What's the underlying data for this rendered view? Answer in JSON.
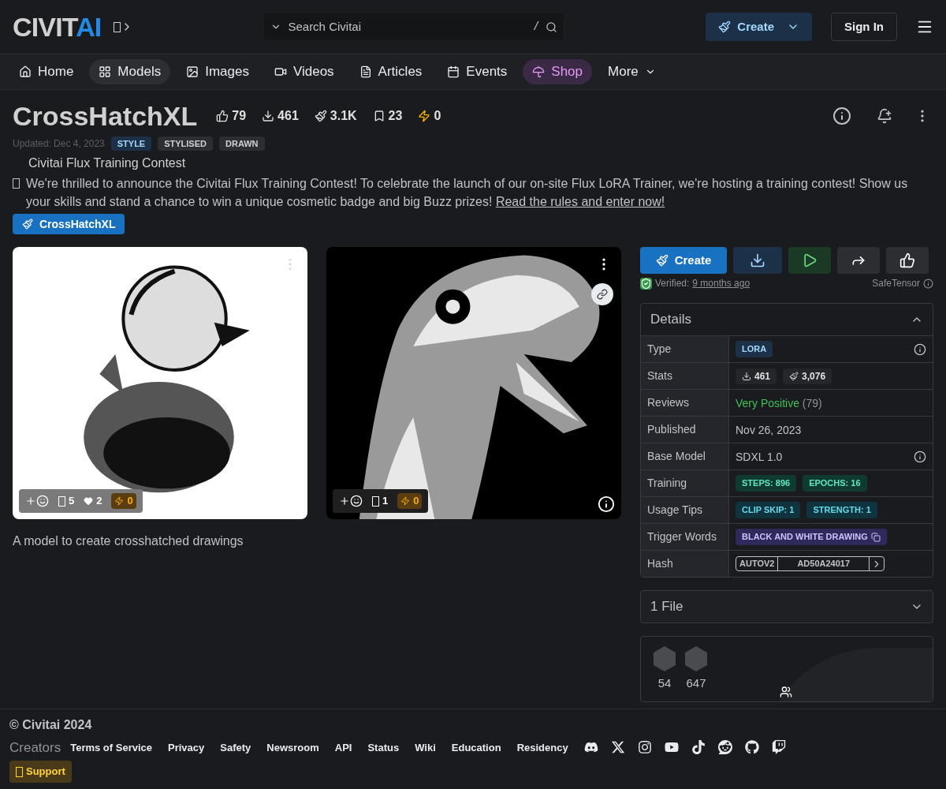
{
  "header": {
    "logo": {
      "main": "CIVIT",
      "accent": "AI"
    },
    "search": {
      "placeholder": "Search Civitai",
      "shortcut": "/"
    },
    "create_button": "Create",
    "sign_in_button": "Sign In"
  },
  "nav": [
    {
      "label": "Home",
      "kind": "link",
      "selected": false
    },
    {
      "label": "Models",
      "kind": "link",
      "selected": true
    },
    {
      "label": "Images",
      "kind": "link",
      "selected": false
    },
    {
      "label": "Videos",
      "kind": "link",
      "selected": false
    },
    {
      "label": "Articles",
      "kind": "link",
      "selected": false
    },
    {
      "label": "Events",
      "kind": "link",
      "selected": false
    },
    {
      "label": "Shop",
      "kind": "shop",
      "selected": false
    },
    {
      "label": "More",
      "kind": "menu",
      "selected": false
    }
  ],
  "model": {
    "title": "CrossHatchXL",
    "stats": [
      {
        "kind": "like",
        "value": "79"
      },
      {
        "kind": "download",
        "value": "461"
      },
      {
        "kind": "brush",
        "value": "3.1K"
      },
      {
        "kind": "bookmark",
        "value": "23"
      },
      {
        "kind": "bolt",
        "value": "0"
      }
    ],
    "updated": "Updated: Dec 4, 2023",
    "tags": [
      {
        "label": "STYLE",
        "kind": "category"
      },
      {
        "label": "STYLISED",
        "kind": "tag"
      },
      {
        "label": "DRAWN",
        "kind": "tag"
      }
    ],
    "description": "A model to create crosshatched drawings"
  },
  "announcement": {
    "title": "Civitai Flux Training Contest",
    "text": "We're thrilled to announce the Civitai Flux Training Contest! To celebrate the launch of our on-site Flux LoRA Trainer, we're hosting a training contest! Show us your skills and stand a chance to win a unique cosmetic badge and big Buzz prizes!",
    "link": "Read the rules and enter now!",
    "button": "CrossHatchXL"
  },
  "images": [
    {
      "kind": "light",
      "reactions": [
        {
          "kind": "glyph",
          "value": "5"
        },
        {
          "kind": "heart",
          "value": "2"
        }
      ],
      "buzz": "0"
    },
    {
      "kind": "dark",
      "reactions": [
        {
          "kind": "glyph",
          "value": "1"
        }
      ],
      "buzz": "0"
    }
  ],
  "actions": {
    "create": "Create",
    "verified_label": "Verified:",
    "verified_time": "9 months ago",
    "format": "SafeTensor"
  },
  "details": {
    "title": "Details",
    "expanded": true,
    "rows": [
      {
        "label": "Type",
        "kind": "type",
        "badges": [
          "LORA"
        ],
        "info": true
      },
      {
        "label": "Stats",
        "kind": "stats",
        "stats": [
          {
            "kind": "download",
            "value": "461"
          },
          {
            "kind": "brush",
            "value": "3,076"
          }
        ]
      },
      {
        "label": "Reviews",
        "kind": "reviews",
        "rating": "Very Positive",
        "count": "(79)"
      },
      {
        "label": "Published",
        "kind": "text",
        "value": "Nov 26, 2023"
      },
      {
        "label": "Base Model",
        "kind": "text",
        "value": "SDXL 1.0",
        "info": true
      },
      {
        "label": "Training",
        "kind": "training",
        "badges": [
          "STEPS: 896",
          "EPOCHS: 16"
        ]
      },
      {
        "label": "Usage Tips",
        "kind": "tips",
        "badges": [
          "CLIP SKIP: 1",
          "STRENGTH: 1"
        ]
      },
      {
        "label": "Trigger Words",
        "kind": "trigger",
        "badges": [
          "BLACK AND WHITE DRAWING"
        ]
      },
      {
        "label": "Hash",
        "kind": "hash",
        "hash_type": "AUTOV2",
        "hash": "AD50A24017"
      }
    ]
  },
  "files": {
    "title": "1 File",
    "expanded": false
  },
  "creator_card": {
    "counts": [
      "54",
      "647"
    ]
  },
  "footer": {
    "copyright": "© Civitai 2024",
    "creators": "Creators",
    "links": [
      "Terms of Service",
      "Privacy",
      "Safety",
      "Newsroom",
      "API",
      "Status",
      "Wiki",
      "Education",
      "Residency"
    ],
    "support": "Support"
  }
}
